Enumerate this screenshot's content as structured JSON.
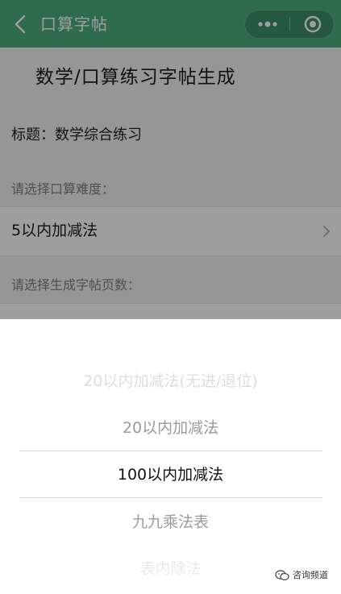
{
  "colors": {
    "navbar": "#4cae7f",
    "mask": "rgba(0,0,0,0.38)",
    "picker_selected": "#111111",
    "picker_muted": "#9a9a9a",
    "picker_faded": "#cfcfcf"
  },
  "navbar": {
    "title": "口算字帖",
    "back_icon": "chevron-left-icon",
    "more_icon": "more-dots-icon",
    "close_icon": "target-close-icon"
  },
  "page": {
    "title": "数学/口算练习字帖生成",
    "title_field": "标题：数学综合练习",
    "difficulty_label": "请选择口算难度：",
    "difficulty_value": "5以内加减法",
    "pages_label": "请选择生成字帖页数："
  },
  "picker": {
    "items": [
      "20以内加减法(无进/退位)",
      "20以内加减法",
      "100以内加减法",
      "九九乘法表",
      "表内除法"
    ],
    "selected_index": 2
  },
  "watermark": {
    "text": "咨询频道"
  }
}
